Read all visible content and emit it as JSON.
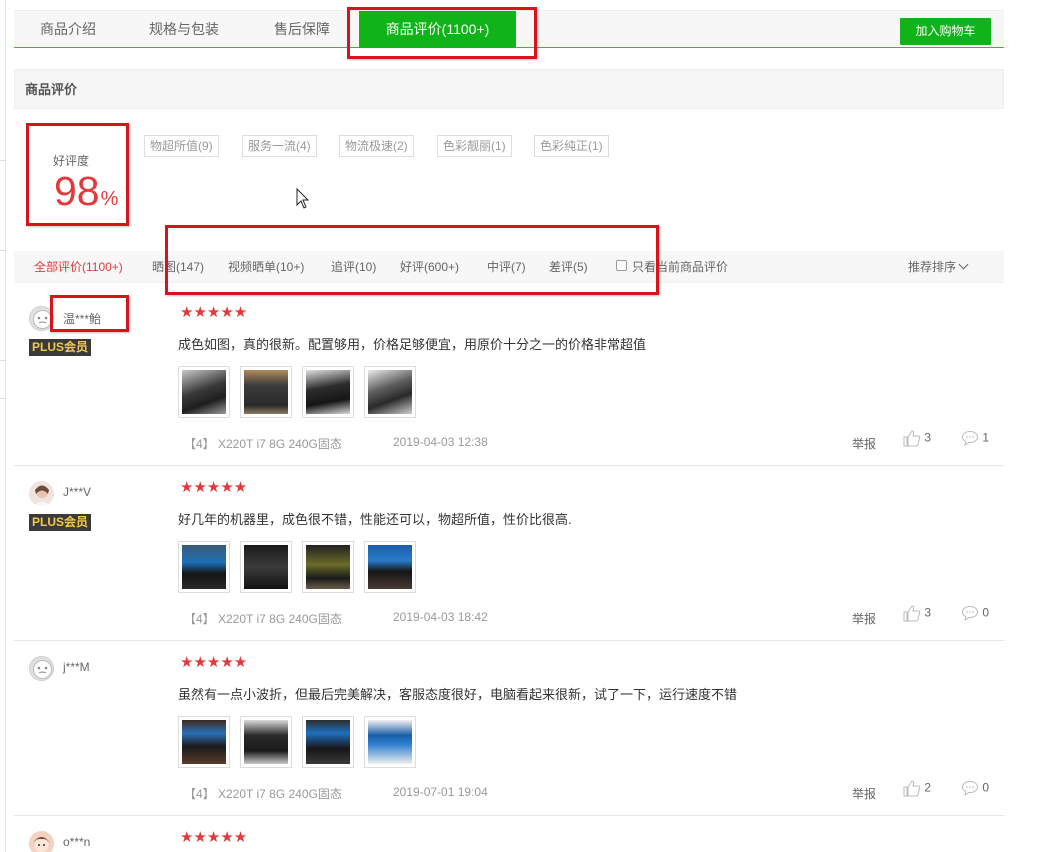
{
  "tabs": [
    {
      "label": "商品介绍"
    },
    {
      "label": "规格与包装"
    },
    {
      "label": "售后保障"
    },
    {
      "label": "商品评价(1100+)"
    }
  ],
  "add_to_cart": "加入购物车",
  "section_title": "商品评价",
  "rating": {
    "label": "好评度",
    "value": "98",
    "unit": "%"
  },
  "tags": [
    "物超所值(9)",
    "服务一流(4)",
    "物流极速(2)",
    "色彩靓丽(1)",
    "色彩纯正(1)"
  ],
  "filters": {
    "all": "全部评价(1100+)",
    "photo": "晒图(147)",
    "video": "视频晒单(10+)",
    "follow_up": "追评(10)",
    "good": "好评(600+)",
    "medium": "中评(7)",
    "bad": "差评(5)",
    "only_current": "只看当前商品评价",
    "sort": "推荐排序"
  },
  "reviews": [
    {
      "user": "温***鲐",
      "badge": "PLUS会员",
      "stars": "★★★★★",
      "text": "成色如图，真的很新。配置够用，价格足够便宜，用原价十分之一的价格非常超值",
      "product": "【4】 X220T i7 8G 240G固态",
      "date": "2019-04-03 12:38",
      "report": "举报",
      "likes": "3",
      "comments": "1"
    },
    {
      "user": "J***V",
      "badge": "PLUS会员",
      "stars": "★★★★★",
      "text": "好几年的机器里，成色很不错，性能还可以，物超所值，性价比很高.",
      "product": "【4】 X220T i7 8G 240G固态",
      "date": "2019-04-03 18:42",
      "report": "举报",
      "likes": "3",
      "comments": "0"
    },
    {
      "user": "j***M",
      "stars": "★★★★★",
      "text": "虽然有一点小波折，但最后完美解决，客服态度很好，电脑看起来很新，试了一下，运行速度不错",
      "product": "【4】 X220T i7 8G 240G固态",
      "date": "2019-07-01 19:04",
      "report": "举报",
      "likes": "2",
      "comments": "0"
    },
    {
      "user": "o***n",
      "stars": "★★★★★"
    }
  ],
  "colors": {
    "accent_green": "#10b418",
    "accent_red": "#e4393c",
    "highlight_box": "#d9131d"
  }
}
